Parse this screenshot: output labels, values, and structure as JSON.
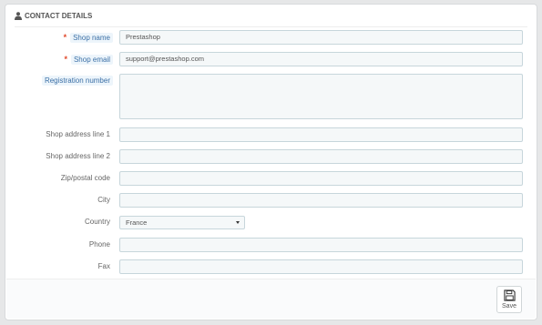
{
  "panel": {
    "title": "CONTACT DETAILS",
    "icon": "user-icon"
  },
  "fields": {
    "shop_name": {
      "label": "Shop name",
      "value": "Prestashop",
      "required": "*"
    },
    "shop_email": {
      "label": "Shop email",
      "value": "support@prestashop.com",
      "required": "*"
    },
    "registration_number": {
      "label": "Registration number",
      "value": ""
    },
    "address1": {
      "label": "Shop address line 1",
      "value": ""
    },
    "address2": {
      "label": "Shop address line 2",
      "value": ""
    },
    "postcode": {
      "label": "Zip/postal code",
      "value": ""
    },
    "city": {
      "label": "City",
      "value": ""
    },
    "country": {
      "label": "Country",
      "value": "France"
    },
    "phone": {
      "label": "Phone",
      "value": ""
    },
    "fax": {
      "label": "Fax",
      "value": ""
    }
  },
  "footer": {
    "save_label": "Save",
    "save_icon": "floppy-disk-icon"
  },
  "colors": {
    "required": "#e0482a",
    "hint_label_bg": "#edf5fb",
    "hint_label_text": "#3b6fa6",
    "field_bg": "#f5f8f9",
    "field_border": "#c7d6db"
  }
}
